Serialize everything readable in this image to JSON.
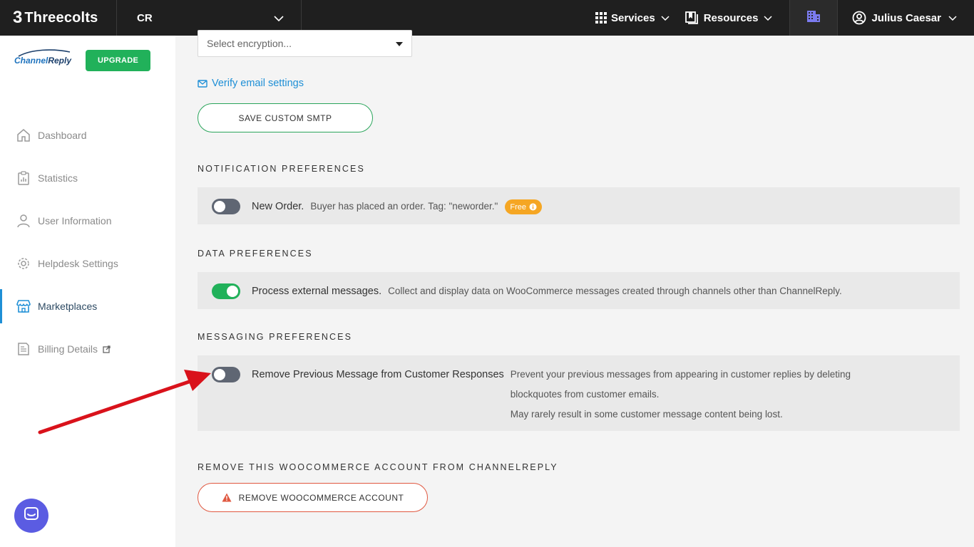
{
  "topbar": {
    "brand_mark": "3",
    "brand_name": "Threecolts",
    "workspace": "CR",
    "services_label": "Services",
    "resources_label": "Resources",
    "user_name": "Julius Caesar"
  },
  "sidebar": {
    "logo_part1": "Channel",
    "logo_part2": "Reply",
    "upgrade_label": "UPGRADE",
    "items": [
      {
        "label": "Dashboard",
        "icon": "home-icon"
      },
      {
        "label": "Statistics",
        "icon": "clipboard-icon"
      },
      {
        "label": "User Information",
        "icon": "user-icon"
      },
      {
        "label": "Helpdesk Settings",
        "icon": "gear-icon"
      },
      {
        "label": "Marketplaces",
        "icon": "store-icon",
        "active": true
      },
      {
        "label": "Billing Details",
        "icon": "invoice-icon",
        "external": true
      }
    ]
  },
  "main": {
    "encryption_placeholder": "Select encryption...",
    "verify_link": "Verify email settings",
    "save_smtp_label": "SAVE CUSTOM SMTP",
    "notification": {
      "title": "NOTIFICATION PREFERENCES",
      "item_title": "New Order.",
      "item_desc": "Buyer has placed an order. Tag: \"neworder.\"",
      "badge": "Free",
      "enabled": false
    },
    "data": {
      "title": "DATA PREFERENCES",
      "item_title": "Process external messages.",
      "item_desc": "Collect and display data on WooCommerce messages created through channels other than ChannelReply.",
      "enabled": true
    },
    "messaging": {
      "title": "MESSAGING PREFERENCES",
      "item_title": "Remove Previous Message from Customer Responses",
      "desc_line1": "Prevent your previous messages from appearing in customer replies by deleting",
      "desc_line2": "blockquotes from customer emails.",
      "desc_line3": "May rarely result in some customer message content being lost.",
      "enabled": false
    },
    "remove": {
      "title": "REMOVE THIS WOOCOMMERCE ACCOUNT FROM CHANNELREPLY",
      "button_label": "REMOVE WOOCOMMERCE ACCOUNT"
    }
  },
  "colors": {
    "accent_green": "#21b15a",
    "link_blue": "#1e8fd6",
    "warning_red": "#e05840",
    "badge_orange": "#f5a623",
    "arrow_red": "#d9121b"
  }
}
